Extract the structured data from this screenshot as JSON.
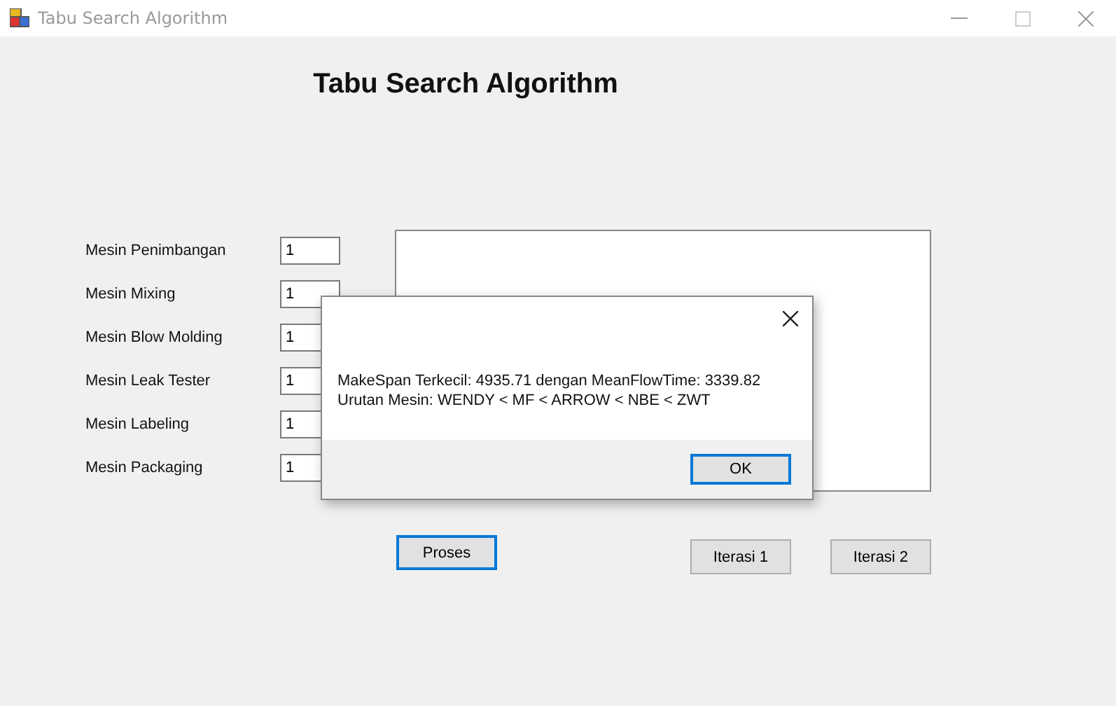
{
  "window": {
    "title": "Tabu Search Algorithm"
  },
  "heading": "Tabu Search Algorithm",
  "machines": [
    {
      "label": "Mesin Penimbangan",
      "value": "1"
    },
    {
      "label": "Mesin Mixing",
      "value": "1"
    },
    {
      "label": "Mesin Blow Molding",
      "value": "1"
    },
    {
      "label": "Mesin Leak Tester",
      "value": "1"
    },
    {
      "label": "Mesin Labeling",
      "value": "1"
    },
    {
      "label": "Mesin Packaging",
      "value": "1"
    }
  ],
  "buttons": [
    {
      "label": "Proses",
      "focused": true
    },
    {
      "label": "Iterasi 1",
      "focused": false
    },
    {
      "label": "Iterasi 2",
      "focused": false
    }
  ],
  "dialog": {
    "lines": [
      "MakeSpan Terkecil: 4935.71 dengan MeanFlowTime: 3339.82",
      "Urutan Mesin: WENDY < MF < ARROW < NBE < ZWT"
    ],
    "button": "OK"
  }
}
